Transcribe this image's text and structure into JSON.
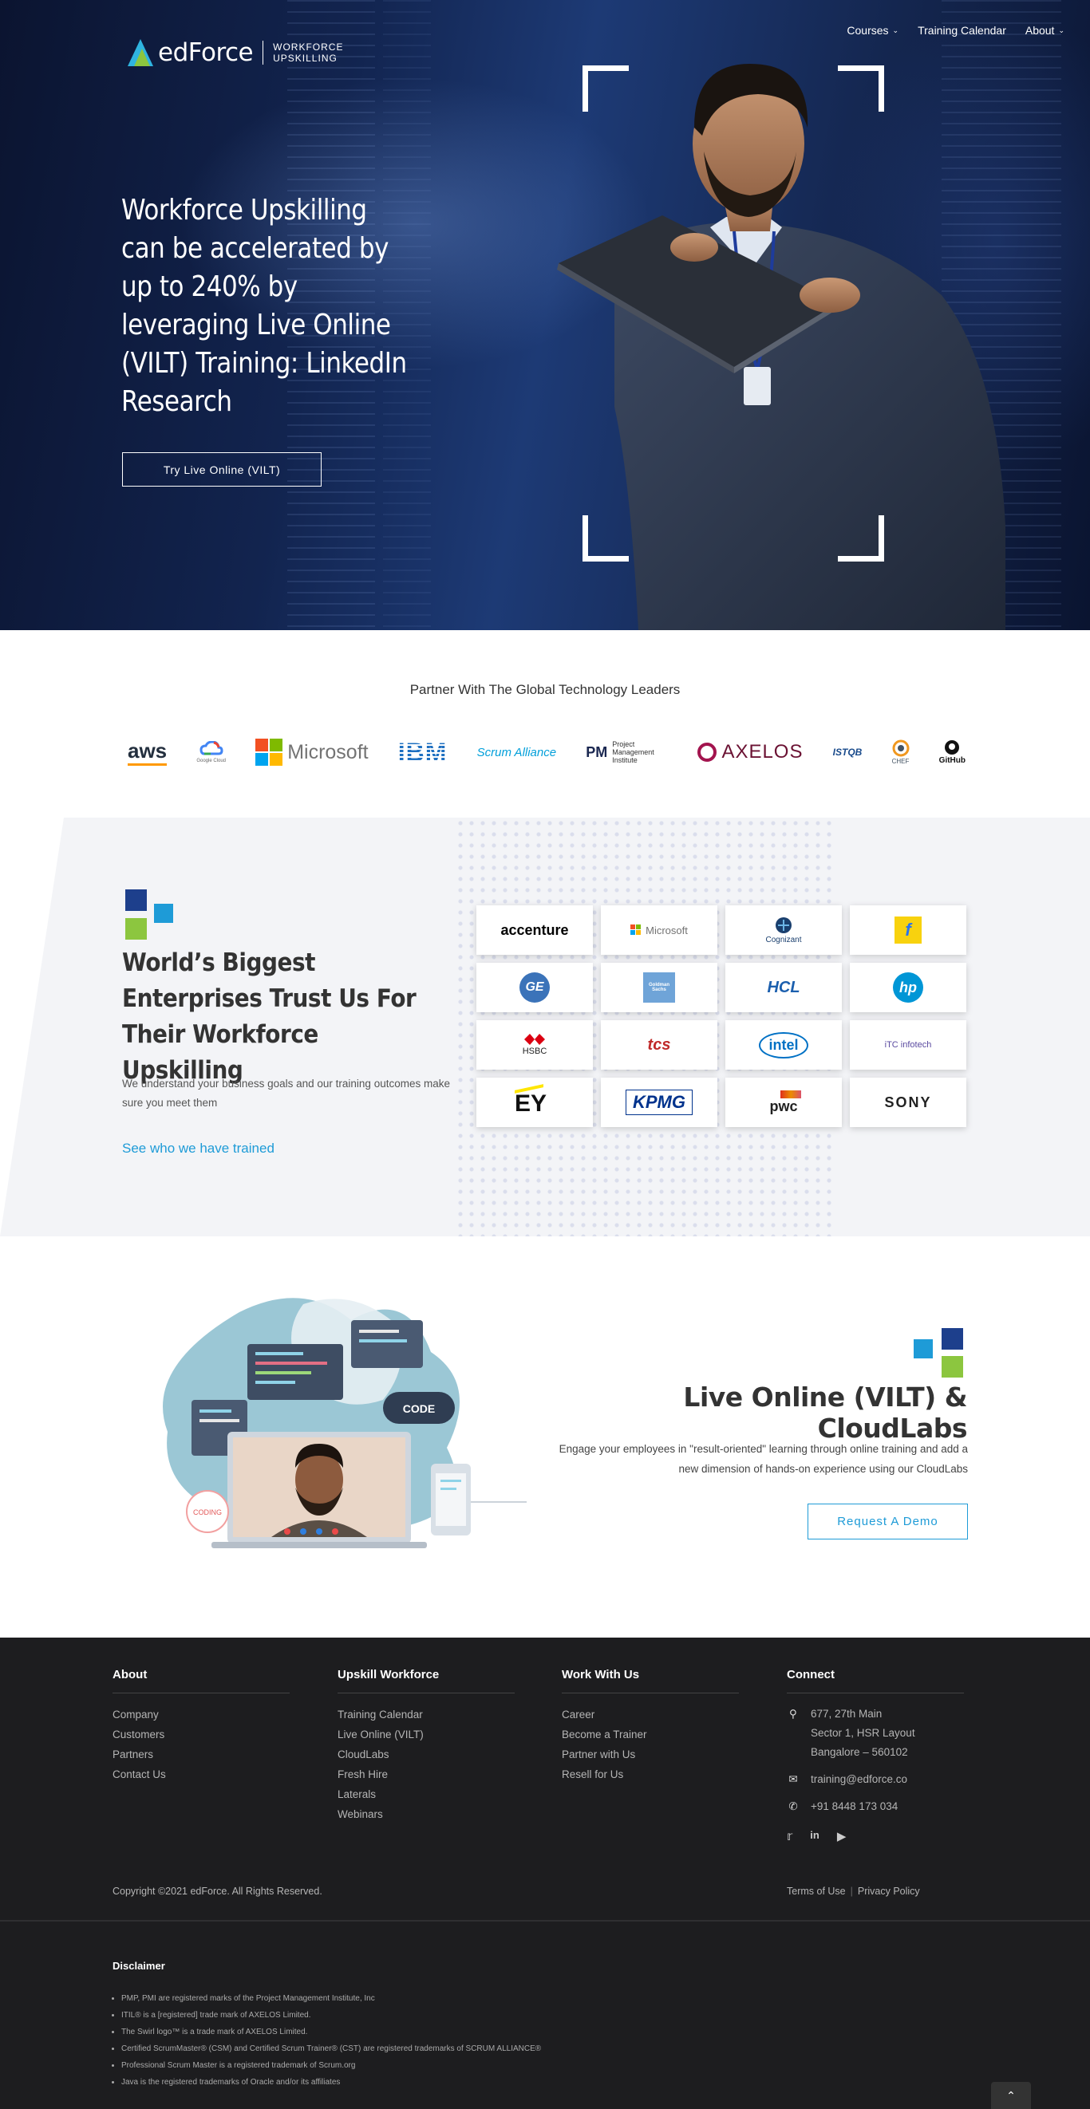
{
  "header": {
    "logo_name": "edForce",
    "logo_tagline_1": "WORKFORCE",
    "logo_tagline_2": "UPSKILLING",
    "nav": [
      {
        "label": "Courses",
        "has_dropdown": true
      },
      {
        "label": "Training Calendar",
        "has_dropdown": false
      },
      {
        "label": "About",
        "has_dropdown": true
      }
    ]
  },
  "hero": {
    "title": "Workforce Upskilling can be accelerated by up to 240% by leveraging Live Online (VILT) Training: LinkedIn Research",
    "cta_label": "Try Live Online (VILT)"
  },
  "partners": {
    "title": "Partner With The Global Technology Leaders",
    "logos": [
      "aws",
      "Google Cloud",
      "Microsoft",
      "IBM",
      "Scrum Alliance",
      "Project Management Institute",
      "AXELOS",
      "ISTQB",
      "CHEF",
      "GitHub"
    ]
  },
  "enterprises": {
    "title": "World’s Biggest Enterprises Trust Us For Their Workforce Upskilling",
    "description": "We understand your business goals and our training outcomes make sure you meet them",
    "link_label": "See who we have trained",
    "clients": [
      "accenture",
      "Microsoft",
      "Cognizant",
      "Flipkart",
      "GE",
      "Goldman Sachs",
      "HCL",
      "hp",
      "HSBC",
      "tcs",
      "intel",
      "iTC infotech",
      "EY",
      "KPMG",
      "pwc",
      "SONY"
    ]
  },
  "vilt": {
    "title": "Live Online (VILT) & CloudLabs",
    "description": "Engage your employees in \"result-oriented\" learning through online training and add a new dimension of hands-on experience using our CloudLabs",
    "cta_label": "Request A Demo",
    "illustration_labels": [
      "CODE",
      "CODING"
    ]
  },
  "footer": {
    "columns": [
      {
        "title": "About",
        "links": [
          "Company",
          "Customers",
          "Partners",
          "Contact Us"
        ]
      },
      {
        "title": "Upskill Workforce",
        "links": [
          "Training Calendar",
          "Live Online (VILT)",
          "CloudLabs",
          "Fresh Hire",
          "Laterals",
          "Webinars"
        ]
      },
      {
        "title": "Work With Us",
        "links": [
          "Career",
          "Become a Trainer",
          "Partner with Us",
          "Resell for Us"
        ]
      }
    ],
    "connect": {
      "title": "Connect",
      "address_1": "677, 27th Main",
      "address_2": "Sector 1, HSR Layout",
      "address_3": "Bangalore – 560102",
      "email": "training@edforce.co",
      "phone": "+91 8448 173 034",
      "social": [
        "twitter-icon",
        "linkedin-icon",
        "youtube-icon"
      ]
    },
    "copyright": "Copyright ©2021 edForce. All Rights Reserved.",
    "terms_label": "Terms of Use",
    "privacy_label": "Privacy Policy",
    "disclaimer_title": "Disclaimer",
    "disclaimers": [
      "PMP, PMI are registered marks of the Project Management Institute, Inc",
      "ITIL® is a [registered] trade mark of AXELOS Limited.",
      "The Swirl logo™ is a trade mark of AXELOS Limited.",
      "Certified ScrumMaster® (CSM) and Certified Scrum Trainer® (CST) are registered trademarks of SCRUM ALLIANCE®",
      "Professional Scrum Master is a registered trademark of Scrum.org",
      "Java is the registered trademarks of Oracle and/or its affiliates"
    ]
  },
  "colors": {
    "accent_blue": "#1e9bd7",
    "accent_green": "#8cc63f",
    "brand_navy": "#1d3f8c",
    "footer_bg": "#1d1d1f"
  }
}
